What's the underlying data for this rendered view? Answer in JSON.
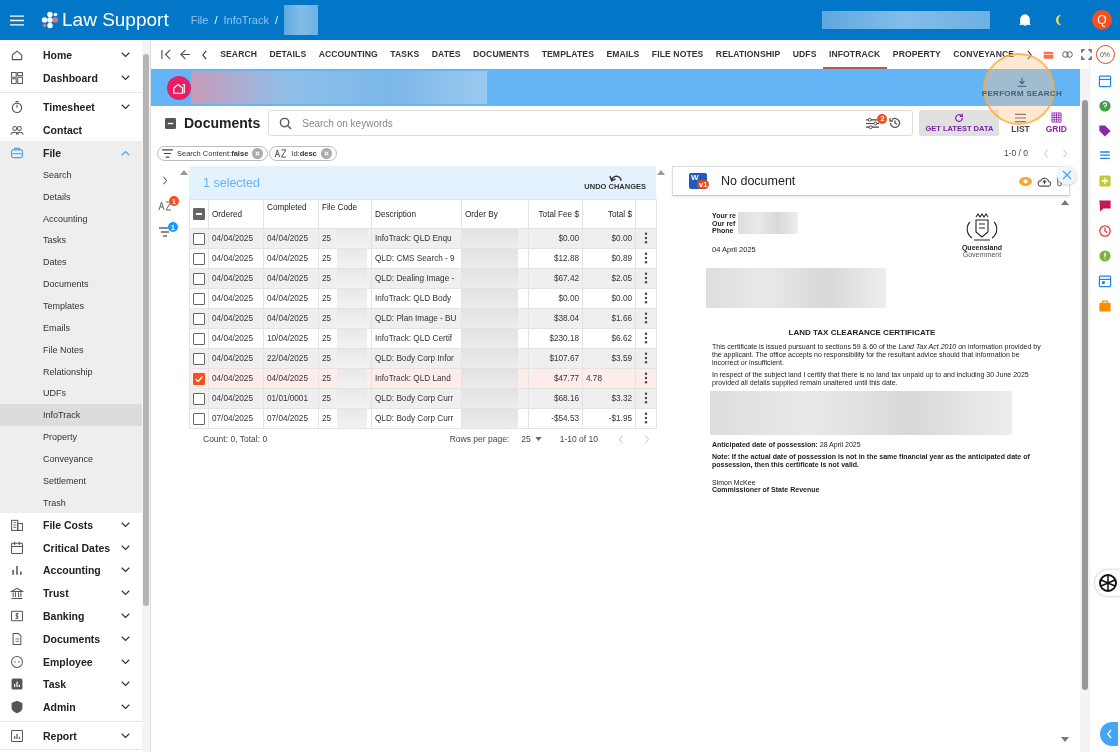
{
  "topbar": {
    "brand": "Law Support",
    "breadcrumbs": [
      "File",
      "/",
      "InfoTrack",
      "/"
    ],
    "avatar": "Q"
  },
  "sidebar": {
    "groups": [
      {
        "items": [
          {
            "label": "Home",
            "expanded": false,
            "selected": false
          },
          {
            "label": "Dashboard",
            "expanded": false,
            "selected": false
          }
        ]
      },
      {
        "items": [
          {
            "label": "Timesheet",
            "expanded": false,
            "selected": false
          },
          {
            "label": "Contact",
            "selected": false
          },
          {
            "label": "File",
            "expanded": true,
            "selected": true,
            "children": [
              {
                "label": "Search",
                "selected": false
              },
              {
                "label": "Details",
                "selected": false
              },
              {
                "label": "Accounting",
                "selected": false
              },
              {
                "label": "Tasks",
                "selected": false
              },
              {
                "label": "Dates",
                "selected": false
              },
              {
                "label": "Documents",
                "selected": false
              },
              {
                "label": "Templates",
                "selected": false
              },
              {
                "label": "Emails",
                "selected": false
              },
              {
                "label": "File Notes",
                "selected": false
              },
              {
                "label": "Relationship",
                "selected": false
              },
              {
                "label": "UDFs",
                "selected": false
              },
              {
                "label": "InfoTrack",
                "selected": true
              },
              {
                "label": "Property",
                "selected": false
              },
              {
                "label": "Conveyance",
                "selected": false
              },
              {
                "label": "Settlement",
                "selected": false
              },
              {
                "label": "Trash",
                "selected": false
              }
            ]
          },
          {
            "label": "File Costs",
            "expanded": false,
            "selected": false
          },
          {
            "label": "Critical Dates",
            "expanded": false,
            "selected": false
          },
          {
            "label": "Accounting",
            "expanded": false,
            "selected": false
          },
          {
            "label": "Trust",
            "expanded": false,
            "selected": false
          },
          {
            "label": "Banking",
            "expanded": false,
            "selected": false
          },
          {
            "label": "Documents",
            "expanded": false,
            "selected": false
          },
          {
            "label": "Employee",
            "expanded": false,
            "selected": false
          },
          {
            "label": "Task",
            "expanded": false,
            "selected": false
          },
          {
            "label": "Admin",
            "expanded": false,
            "selected": false
          }
        ]
      },
      {
        "items": [
          {
            "label": "Report",
            "expanded": false,
            "selected": false
          }
        ]
      }
    ]
  },
  "tabs": [
    {
      "label": "SEARCH",
      "selected": false
    },
    {
      "label": "DETAILS",
      "selected": false
    },
    {
      "label": "ACCOUNTING",
      "selected": false
    },
    {
      "label": "TASKS",
      "selected": false
    },
    {
      "label": "DATES",
      "selected": false
    },
    {
      "label": "DOCUMENTS",
      "selected": false
    },
    {
      "label": "TEMPLATES",
      "selected": false
    },
    {
      "label": "EMAILS",
      "selected": false
    },
    {
      "label": "FILE NOTES",
      "selected": false
    },
    {
      "label": "RELATIONSHIP",
      "selected": false
    },
    {
      "label": "UDFS",
      "selected": false
    },
    {
      "label": "INFOTRACK",
      "selected": true
    },
    {
      "label": "PROPERTY",
      "selected": false
    },
    {
      "label": "CONVEYANCE",
      "selected": false
    }
  ],
  "banner": {
    "action": "PERFORM SEARCH",
    "disabled": true
  },
  "toolbar": {
    "title": "Documents",
    "search": {
      "placeholder": "Search on keywords"
    },
    "filter_badge": "2",
    "get_latest": "GET LATEST DATA",
    "views": [
      {
        "label": "LIST",
        "selected": false
      },
      {
        "label": "GRID",
        "selected": true
      }
    ],
    "paging": "1-0 / 0"
  },
  "chips": [
    "Search Content:**false**",
    "Id:**desc**"
  ],
  "side_badges": {
    "sort": "1",
    "filter": "1"
  },
  "selection": {
    "text": "1 selected",
    "undo": "UNDO CHANGES"
  },
  "table": {
    "indeterminate": true,
    "columns": [
      "Ordered",
      "Completed",
      "File Code",
      "Description",
      "Order By",
      "Total Fee $",
      "Total $"
    ],
    "rows": [
      {
        "checked": false,
        "editing": false,
        "ordered": "04/04/2025",
        "completed": "04/04/2025",
        "file_code": "25",
        "description": "InfoTrack: QLD Enqu",
        "fee": "$0.00",
        "total": "$0.00"
      },
      {
        "checked": false,
        "editing": false,
        "ordered": "04/04/2025",
        "completed": "04/04/2025",
        "file_code": "25",
        "description": "QLD: CMS Search - 9",
        "fee": "$12.88",
        "total": "$0.89"
      },
      {
        "checked": false,
        "editing": false,
        "ordered": "04/04/2025",
        "completed": "04/04/2025",
        "file_code": "25",
        "description": "QLD: Dealing Image -",
        "fee": "$67.42",
        "total": "$2.05"
      },
      {
        "checked": false,
        "editing": false,
        "ordered": "04/04/2025",
        "completed": "04/04/2025",
        "file_code": "25",
        "description": "InfoTrack: QLD Body",
        "fee": "$0.00",
        "total": "$0.00"
      },
      {
        "checked": false,
        "editing": false,
        "ordered": "04/04/2025",
        "completed": "04/04/2025",
        "file_code": "25",
        "description": "QLD: Plan Image - BU",
        "fee": "$38.04",
        "total": "$1.66"
      },
      {
        "checked": false,
        "editing": false,
        "ordered": "04/04/2025",
        "completed": "10/04/2025",
        "file_code": "25",
        "description": "InfoTrack: QLD Certif",
        "fee": "$230.18",
        "total": "$6.62"
      },
      {
        "checked": false,
        "editing": false,
        "ordered": "04/04/2025",
        "completed": "22/04/2025",
        "file_code": "25",
        "description": "QLD: Body Corp Infor",
        "fee": "$107.67",
        "total": "$3.59"
      },
      {
        "checked": true,
        "editing": true,
        "ordered": "04/04/2025",
        "completed": "04/04/2025",
        "file_code": "25",
        "description": "InfoTrack: QLD Land",
        "fee": "$47.77",
        "total": "4.78"
      },
      {
        "checked": false,
        "editing": false,
        "ordered": "04/04/2025",
        "completed": "01/01/0001",
        "file_code": "25",
        "description": "QLD: Body Corp Curr",
        "fee": "$68.16",
        "total": "$3.32"
      },
      {
        "checked": false,
        "editing": false,
        "ordered": "07/04/2025",
        "completed": "07/04/2025",
        "file_code": "25",
        "description": "QLD: Body Corp Curr",
        "fee": "-$54.53",
        "total": "-$1.95"
      }
    ],
    "footer": {
      "count": "Count: 0, Total: 0",
      "rows_label": "Rows per page:",
      "rows_value": "25",
      "range": "1-10 of 10"
    }
  },
  "preview": {
    "title": "No document",
    "icon_letter": "W",
    "version": "v1",
    "document": {
      "refs": [
        "Your re",
        "Our ref",
        "Phone"
      ],
      "date": "04 April 2025",
      "crest": [
        "Queensland",
        "Government"
      ],
      "heading": "LAND TAX CLEARANCE CERTIFICATE",
      "paragraphs": [
        "This certificate is issued pursuant to sections 59 & 60 of the *Land Tax Act 2010* on information provided by the applicant.  The office accepts no responsibility for the resultant advice should that information be incorrect or insufficient.",
        "In respect of the subject land I certify that there is no land tax unpaid up to and including 30 June 2025 provided all details supplied remain unaltered until this date."
      ],
      "possession": "**Anticipated date of possession:** 28 April 2025",
      "note": "Note: If the actual date of possession is not in the same financial year as the anticipated date of possession, then this certificate is not valid.",
      "signatory": "Simon McKee",
      "signatory_title": "Commissioner of State Revenue"
    }
  },
  "right_rail": {
    "progress": "0%"
  }
}
